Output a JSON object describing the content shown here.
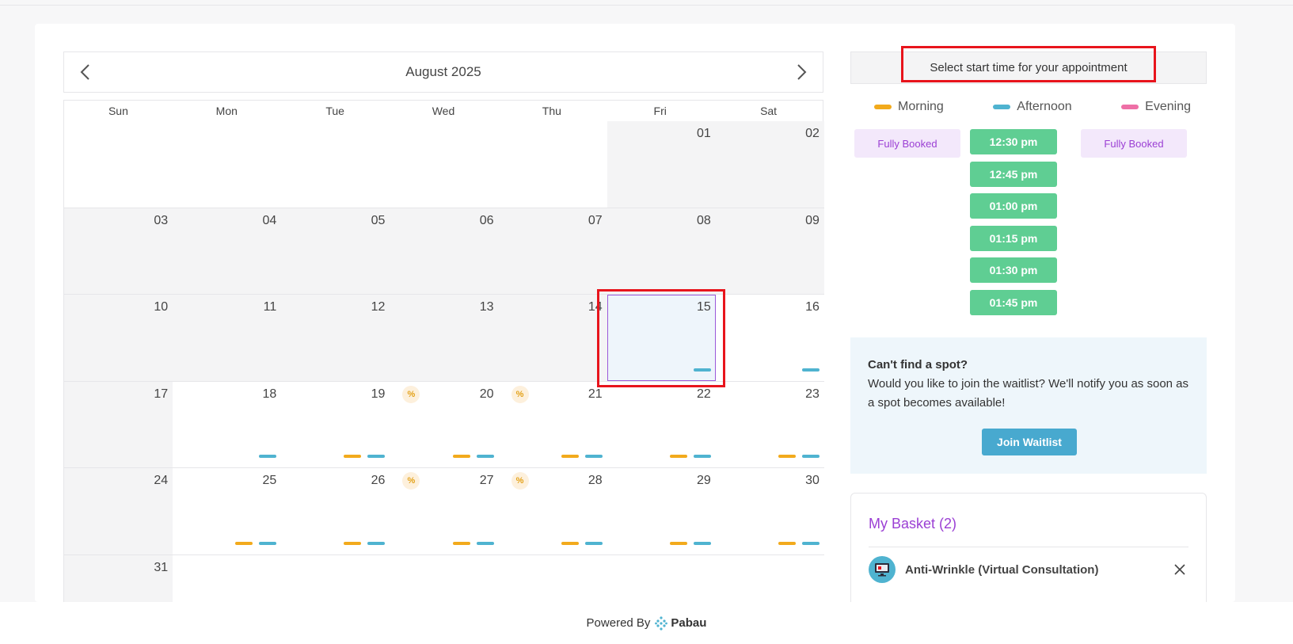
{
  "calendar": {
    "month_label": "August 2025",
    "weekdays": [
      "Sun",
      "Mon",
      "Tue",
      "Wed",
      "Thu",
      "Fri",
      "Sat"
    ],
    "promo_symbol": "%",
    "days": [
      {
        "label": "",
        "style": "blank"
      },
      {
        "label": "",
        "style": "blank"
      },
      {
        "label": "",
        "style": "blank"
      },
      {
        "label": "",
        "style": "blank"
      },
      {
        "label": "",
        "style": "blank"
      },
      {
        "label": "01",
        "style": "gray"
      },
      {
        "label": "02",
        "style": "gray"
      },
      {
        "label": "03",
        "style": "gray"
      },
      {
        "label": "04",
        "style": "gray"
      },
      {
        "label": "05",
        "style": "gray"
      },
      {
        "label": "06",
        "style": "gray"
      },
      {
        "label": "07",
        "style": "gray"
      },
      {
        "label": "08",
        "style": "gray"
      },
      {
        "label": "09",
        "style": "gray"
      },
      {
        "label": "10",
        "style": "gray"
      },
      {
        "label": "11",
        "style": "gray"
      },
      {
        "label": "12",
        "style": "gray"
      },
      {
        "label": "13",
        "style": "gray"
      },
      {
        "label": "14",
        "style": "gray"
      },
      {
        "label": "15",
        "style": "selected",
        "afternoon": true
      },
      {
        "label": "16",
        "style": "white",
        "afternoon": true
      },
      {
        "label": "17",
        "style": "gray"
      },
      {
        "label": "18",
        "style": "white",
        "afternoon": true
      },
      {
        "label": "19",
        "style": "white",
        "morning": true,
        "afternoon": true,
        "promo": true
      },
      {
        "label": "20",
        "style": "white",
        "morning": true,
        "afternoon": true,
        "promo": true
      },
      {
        "label": "21",
        "style": "white",
        "morning": true,
        "afternoon": true
      },
      {
        "label": "22",
        "style": "white",
        "morning": true,
        "afternoon": true
      },
      {
        "label": "23",
        "style": "white",
        "morning": true,
        "afternoon": true
      },
      {
        "label": "24",
        "style": "gray"
      },
      {
        "label": "25",
        "style": "white",
        "morning": true,
        "afternoon": true
      },
      {
        "label": "26",
        "style": "white",
        "morning": true,
        "afternoon": true,
        "promo": true
      },
      {
        "label": "27",
        "style": "white",
        "morning": true,
        "afternoon": true,
        "promo": true
      },
      {
        "label": "28",
        "style": "white",
        "morning": true,
        "afternoon": true
      },
      {
        "label": "29",
        "style": "white",
        "morning": true,
        "afternoon": true
      },
      {
        "label": "30",
        "style": "white",
        "morning": true,
        "afternoon": true
      },
      {
        "label": "31",
        "style": "gray"
      },
      {
        "label": "",
        "style": "white"
      },
      {
        "label": "",
        "style": "white"
      },
      {
        "label": "",
        "style": "white"
      },
      {
        "label": "",
        "style": "white"
      },
      {
        "label": "",
        "style": "white"
      },
      {
        "label": "",
        "style": "white"
      }
    ]
  },
  "times": {
    "header": "Select start time for your appointment",
    "legend": [
      {
        "label": "Morning",
        "color": "#f2aa1c"
      },
      {
        "label": "Afternoon",
        "color": "#4fb3d0"
      },
      {
        "label": "Evening",
        "color": "#ee6fa6"
      }
    ],
    "morning_status": "Fully Booked",
    "evening_status": "Fully Booked",
    "afternoon_slots": [
      "12:30 pm",
      "12:45 pm",
      "01:00 pm",
      "01:15 pm",
      "01:30 pm",
      "01:45 pm"
    ]
  },
  "waitlist": {
    "title": "Can't find a spot?",
    "text": "Would you like to join the waitlist? We'll notify you as soon as a spot becomes available!",
    "button": "Join Waitlist"
  },
  "basket": {
    "title": "My Basket (2)",
    "items": [
      {
        "name": "Anti-Wrinkle (Virtual Consultation)",
        "icon": "monitor-icon"
      }
    ]
  },
  "footer": {
    "powered_by": "Powered By",
    "brand": "Pabau"
  },
  "colors": {
    "accent": "#9b3fd4",
    "slot_green": "#5fce93",
    "highlight_red": "#e8141c"
  }
}
